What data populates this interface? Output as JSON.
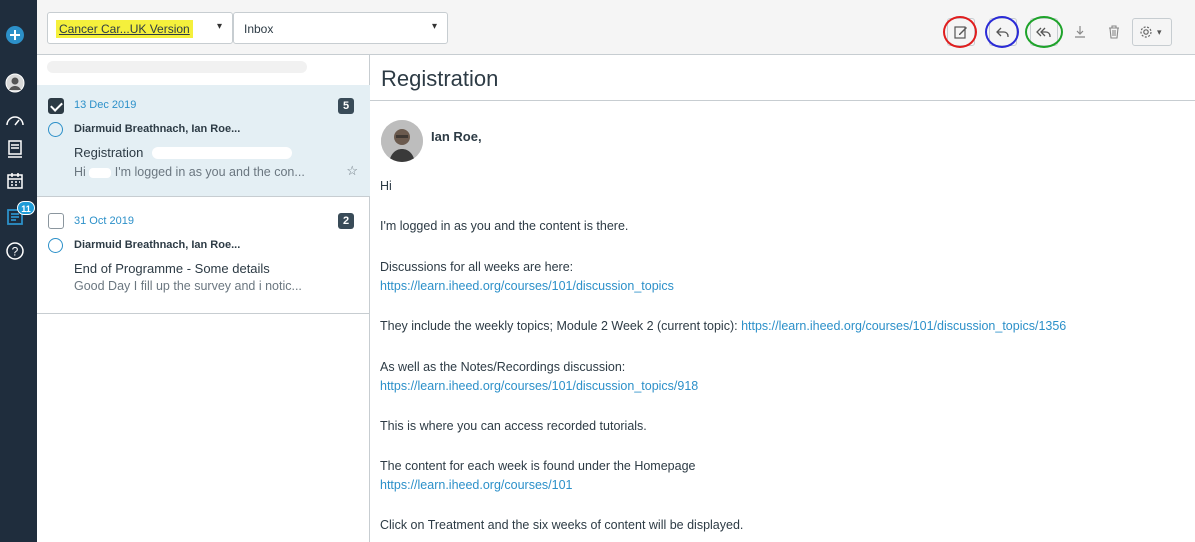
{
  "nav": {
    "badge_count": "11"
  },
  "toolbar": {
    "course_filter": "Cancer Car...UK Version",
    "course_caret": "▾",
    "mailbox": "Inbox",
    "mailbox_caret": "▾",
    "settings_caret": "▾",
    "buttons": [
      "compose-icon",
      "reply-icon",
      "reply-all-icon",
      "archive-icon",
      "delete-icon",
      "settings-icon"
    ],
    "ring_colors": {
      "compose": "#e01e1e",
      "reply": "#2b2bd6",
      "reply_all": "#1ea32a"
    }
  },
  "conversations": [
    {
      "date": "13 Dec 2019",
      "count": "5",
      "participants": "Diarmuid Breathnach, Ian Roe...",
      "subject": "Registration",
      "preview_prefix": "Hi",
      "preview": "I'm logged in as you and the con...",
      "star": "☆",
      "selected": true
    },
    {
      "date": "31 Oct 2019",
      "count": "2",
      "participants": "Diarmuid Breathnach, Ian Roe...",
      "subject": "End of Programme - Some details",
      "preview": "Good Day I fill up the survey and i notic...",
      "selected": false
    }
  ],
  "message": {
    "title": "Registration",
    "author": "Ian Roe,",
    "greeting": "Hi",
    "p1": "I'm logged in as you and the content is there.",
    "p2_text": "Discussions for all weeks are here:",
    "p2_link": "https://learn.iheed.org/courses/101/discussion_topics",
    "p3_text": "They include the weekly topics; Module 2 Week 2 (current topic): ",
    "p3_link": "https://learn.iheed.org/courses/101/discussion_topics/1356",
    "p4_text": "As well as the Notes/Recordings discussion:",
    "p4_link": "https://learn.iheed.org/courses/101/discussion_topics/918",
    "p5": "This is where you can access recorded tutorials.",
    "p6_text": "The content for each week is found under the Homepage",
    "p6_link": "https://learn.iheed.org/courses/101",
    "p7": "Click on Treatment and the six weeks of content will be displayed."
  }
}
